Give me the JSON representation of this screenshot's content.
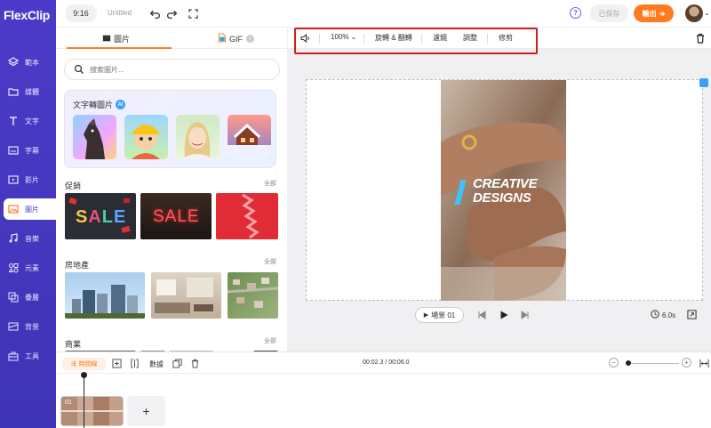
{
  "app": {
    "logo": "FlexClip",
    "ratio": "9:16",
    "doc_title": "Untitled",
    "saved_label": "已保存",
    "export_label": "輸出",
    "help_label": "?"
  },
  "sidebar": {
    "items": [
      {
        "label": "範本",
        "icon": "layers-icon"
      },
      {
        "label": "媒體",
        "icon": "folder-icon"
      },
      {
        "label": "文字",
        "icon": "text-icon"
      },
      {
        "label": "字幕",
        "icon": "subtitle-icon"
      },
      {
        "label": "影片",
        "icon": "video-icon"
      },
      {
        "label": "圖片",
        "icon": "image-icon",
        "active": true
      },
      {
        "label": "音樂",
        "icon": "music-icon"
      },
      {
        "label": "元素",
        "icon": "elements-icon"
      },
      {
        "label": "疊層",
        "icon": "overlay-icon"
      },
      {
        "label": "背景",
        "icon": "background-icon"
      },
      {
        "label": "工具",
        "icon": "toolbox-icon"
      }
    ]
  },
  "panel": {
    "tab_image": "圖片",
    "tab_gif": "GIF",
    "search_placeholder": "搜索圖片...",
    "ai_title": "文字轉圖片",
    "ai_badge": "AI",
    "sections": [
      {
        "title": "促銷",
        "all": "全部"
      },
      {
        "title": "房地產",
        "all": "全部"
      },
      {
        "title": "商業",
        "all": "全部"
      }
    ],
    "sale_text": "SALE"
  },
  "canvas_toolbar": {
    "zoom": "100%",
    "rotate": "旋轉 & 翻轉",
    "filter": "濾鏡",
    "adjust": "調整",
    "crop": "修剪"
  },
  "video": {
    "title_line1": "CREATIVE",
    "title_line2": "DESIGNS"
  },
  "playback": {
    "scene": "場景 01",
    "duration": "6.0s"
  },
  "timeline": {
    "timeline_label": "時間線",
    "data_label": "數據",
    "time": "00:02.3 / 00:06.0",
    "clip_number": "01",
    "add": "+"
  },
  "colors": {
    "brand": "#4c3bc8",
    "accent": "#ff7b22",
    "highlight": "#d61c1c"
  }
}
